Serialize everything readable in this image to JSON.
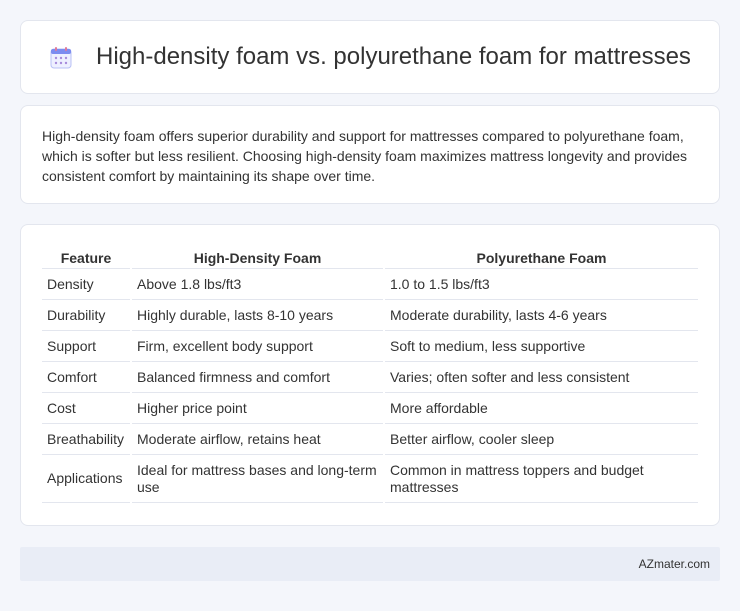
{
  "header": {
    "title": "High-density foam vs. polyurethane foam for mattresses",
    "icon": "calendar-icon"
  },
  "intro": {
    "text": "High-density foam offers superior durability and support for mattresses compared to polyurethane foam, which is softer but less resilient. Choosing high-density foam maximizes mattress longevity and provides consistent comfort by maintaining its shape over time."
  },
  "table": {
    "headers": [
      "Feature",
      "High-Density Foam",
      "Polyurethane Foam"
    ],
    "rows": [
      [
        "Density",
        "Above 1.8 lbs/ft3",
        "1.0 to 1.5 lbs/ft3"
      ],
      [
        "Durability",
        "Highly durable, lasts 8-10 years",
        "Moderate durability, lasts 4-6 years"
      ],
      [
        "Support",
        "Firm, excellent body support",
        "Soft to medium, less supportive"
      ],
      [
        "Comfort",
        "Balanced firmness and comfort",
        "Varies; often softer and less consistent"
      ],
      [
        "Cost",
        "Higher price point",
        "More affordable"
      ],
      [
        "Breathability",
        "Moderate airflow, retains heat",
        "Better airflow, cooler sleep"
      ],
      [
        "Applications",
        "Ideal for mattress bases and long-term use",
        "Common in mattress toppers and budget mattresses"
      ]
    ]
  },
  "footer": {
    "brand": "AZmater.com"
  },
  "colors": {
    "background": "#f4f6fb",
    "card": "#ffffff",
    "footer": "#e9edf6",
    "icon_accent": "#7c8cf0"
  }
}
